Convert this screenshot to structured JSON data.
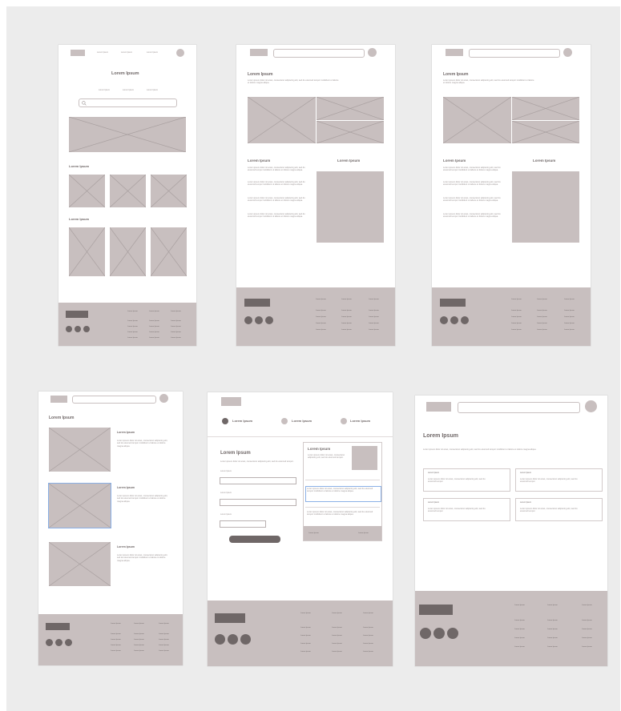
{
  "labels": {
    "heading": "Lorem Ipsum",
    "nav_item": "Lorem Ipsum",
    "para_short": "Lorem ipsum dolor sit amet, consectetur adipiscing elit, sed do eiusmod tempor.",
    "para_long": "Lorem ipsum dolor sit amet, consectetur adipiscing elit, sed do eiusmod tempor incididunt ut labore et dolore magna aliqua.",
    "form_label": "Lorem Ipsum"
  },
  "colors": {
    "canvas": "#ececec",
    "placeholder": "#c8bfbf",
    "dark": "#6f6767",
    "selection": "#8ab0e6"
  },
  "icons": [
    "search-icon",
    "avatar-icon",
    "social-icon"
  ]
}
